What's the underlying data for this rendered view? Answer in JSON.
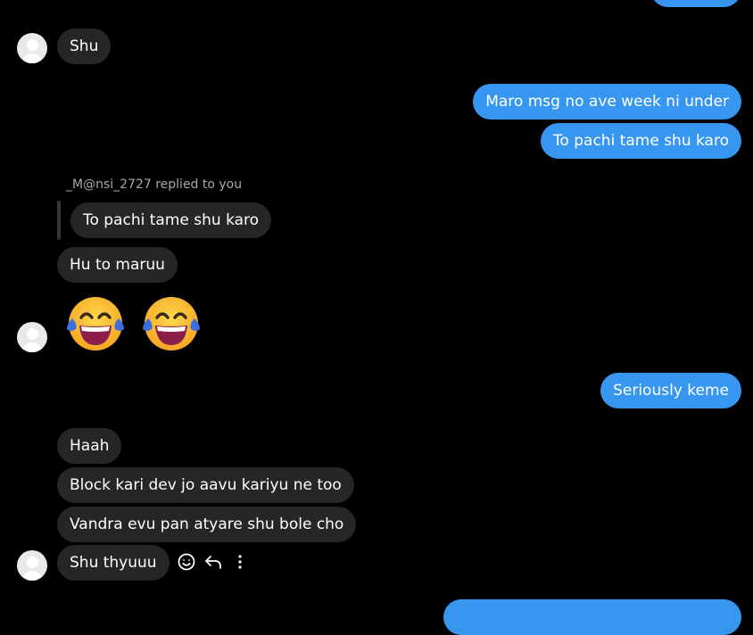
{
  "thread": {
    "received_1": "Shu",
    "sent_1": "Maro msg no ave week ni under",
    "sent_2": "To pachi tame shu karo",
    "reply_meta": "_M@nsi_2727 replied to you",
    "quoted_text": "To pachi tame shu karo",
    "received_2": "Hu to maruu",
    "emoji_name": "face-with-tears-of-joy",
    "sent_3": "Seriously keme",
    "received_3": "Haah",
    "received_4": "Block kari dev jo aavu kariyu ne too",
    "received_5": "Vandra evu pan atyare shu bole cho",
    "received_6": "Shu thyuuu"
  },
  "colors": {
    "background": "#000000",
    "incoming_bubble": "#262626",
    "outgoing_bubble": "#3797f0",
    "meta_text": "#a8a8a8"
  },
  "actions": {
    "react_icon": "smiley-react-icon",
    "reply_icon": "reply-arrow-icon",
    "more_icon": "more-vertical-icon"
  }
}
